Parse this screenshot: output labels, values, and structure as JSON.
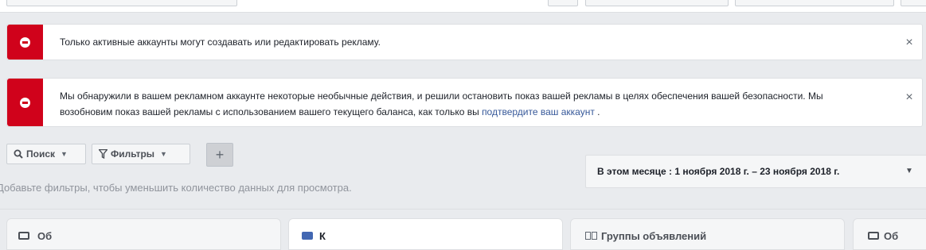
{
  "alerts": [
    {
      "text": "Только активные аккаунты могут создавать или редактировать рекламу.",
      "close": "×"
    },
    {
      "text_before": "Мы обнаружили в вашем рекламном аккаунте некоторые необычные действия, и решили остановить показ вашей рекламы в целях обеспечения вашей безопасности. Мы возобновим показ вашей рекламы с использованием вашего текущего баланса, как только вы ",
      "link": "подтвердите ваш аккаунт",
      "text_after": " .",
      "close": "×"
    }
  ],
  "toolbar": {
    "search_label": "Поиск",
    "filters_label": "Фильтры",
    "add_label": "+",
    "date_range": "В этом месяце : 1 ноября 2018 г. – 23 ноября 2018 г.",
    "hint": "Добавьте фильтры, чтобы уменьшить количество данных для просмотра."
  },
  "icons": {
    "alert": "no-entry-icon",
    "search": "magnifier-icon",
    "filter": "funnel-icon",
    "caret": "caret-down-icon"
  },
  "tabs": [
    {
      "label": "Об"
    },
    {
      "label": "К"
    },
    {
      "label": "Группы объявлений"
    },
    {
      "label": "Об"
    }
  ],
  "colors": {
    "alert_red": "#d0021b",
    "link": "#365899",
    "background": "#e9ebee"
  }
}
